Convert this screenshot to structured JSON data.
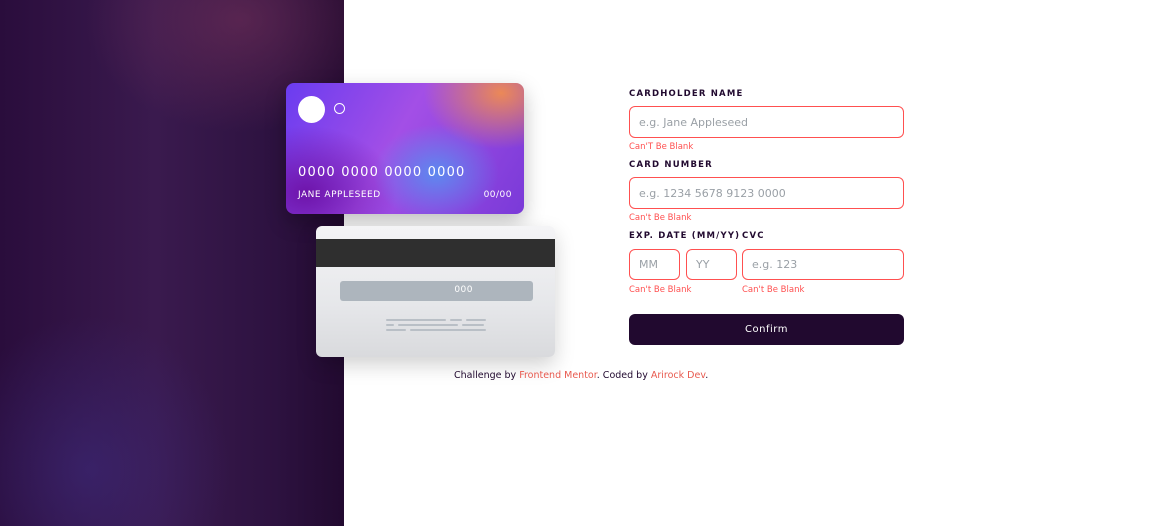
{
  "card_front": {
    "number": "0000 0000 0000 0000",
    "holder": "JANE APPLESEED",
    "expiry": "00/00"
  },
  "card_back": {
    "cvc": "000"
  },
  "form": {
    "cardholder": {
      "label": "CARDHOLDER NAME",
      "placeholder": "e.g. Jane Appleseed",
      "error": "Can'T Be Blank"
    },
    "number": {
      "label": "CARD NUMBER",
      "placeholder": "e.g. 1234 5678 9123 0000",
      "error": "Can't Be Blank"
    },
    "exp": {
      "label": "EXP. DATE (MM/YY)",
      "mm_placeholder": "MM",
      "yy_placeholder": "YY",
      "error": "Can't Be Blank"
    },
    "cvc": {
      "label": "CVC",
      "placeholder": "e.g. 123",
      "error": "Can't Be Blank"
    },
    "confirm_label": "Confirm"
  },
  "attribution": {
    "prefix": "Challenge by ",
    "fm_link": "Frontend Mentor",
    "middle": ". Coded by ",
    "author_link": "Arirock Dev",
    "suffix": "."
  },
  "colors": {
    "error": "#ff5050",
    "button": "#21092f",
    "link": "#e85a4f"
  }
}
